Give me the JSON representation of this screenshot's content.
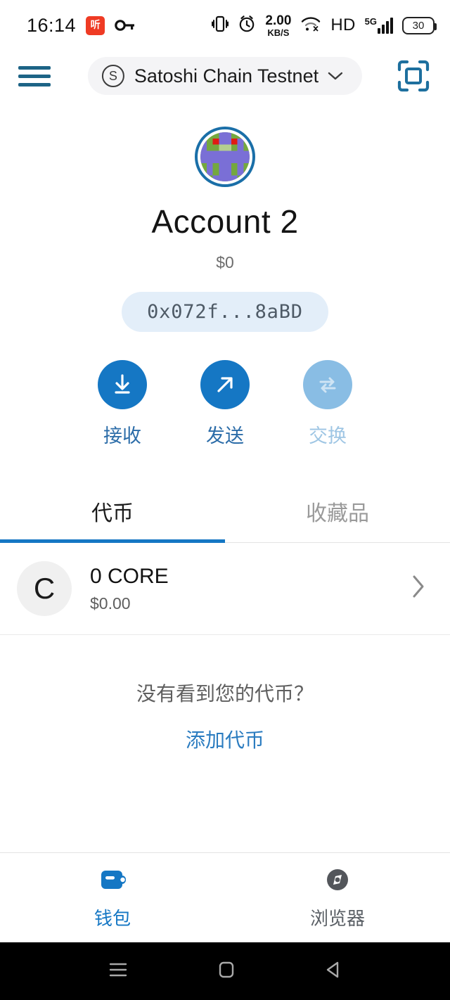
{
  "statusbar": {
    "time": "16:14",
    "app_icon_label": "听",
    "key_icon": "key-icon",
    "vibrate_icon": "vibrate-icon",
    "alarm_icon": "alarm-icon",
    "net_speed_value": "2.00",
    "net_speed_unit": "KB/S",
    "wifi_icon": "wifi-icon",
    "hd_label": "HD",
    "signal_label": "5G",
    "battery_level": "30"
  },
  "appbar": {
    "menu_icon": "hamburger-menu-icon",
    "network_badge": "S",
    "network_name": "Satoshi Chain Testnet",
    "chevron": "⌄",
    "scan_icon": "qr-scan-icon"
  },
  "account": {
    "avatar": "identicon-avatar",
    "name": "Account 2",
    "fiat_balance": "$0",
    "address": "0x072f...8aBD"
  },
  "actions": [
    {
      "label": "接收",
      "icon": "download-arrow-icon",
      "name": "receive",
      "disabled": false
    },
    {
      "label": "发送",
      "icon": "send-arrow-icon",
      "name": "send",
      "disabled": false
    },
    {
      "label": "交换",
      "icon": "swap-arrows-icon",
      "name": "swap",
      "disabled": true
    }
  ],
  "tabs": [
    {
      "label": "代币",
      "name": "tokens",
      "active": true
    },
    {
      "label": "收藏品",
      "name": "collectibles",
      "active": false
    }
  ],
  "tokens": [
    {
      "symbol_letter": "C",
      "amount": "0 CORE",
      "fiat": "$0.00",
      "arrow": "›"
    }
  ],
  "hint": {
    "question": "没有看到您的代币？",
    "link": "添加代币"
  },
  "bottomnav": [
    {
      "label": "钱包",
      "icon": "wallet-icon",
      "name": "wallet",
      "active": true
    },
    {
      "label": "浏览器",
      "icon": "compass-browser-icon",
      "name": "browser",
      "active": false
    }
  ],
  "androidnav": {
    "recents_icon": "recents-icon",
    "home_icon": "home-icon",
    "back_icon": "back-icon"
  },
  "colors": {
    "accent": "#1577c4",
    "accent_dark": "#1d6486",
    "disabled": "#89bde4",
    "address_bg": "#e3eef9",
    "muted": "#9a9a9a"
  }
}
